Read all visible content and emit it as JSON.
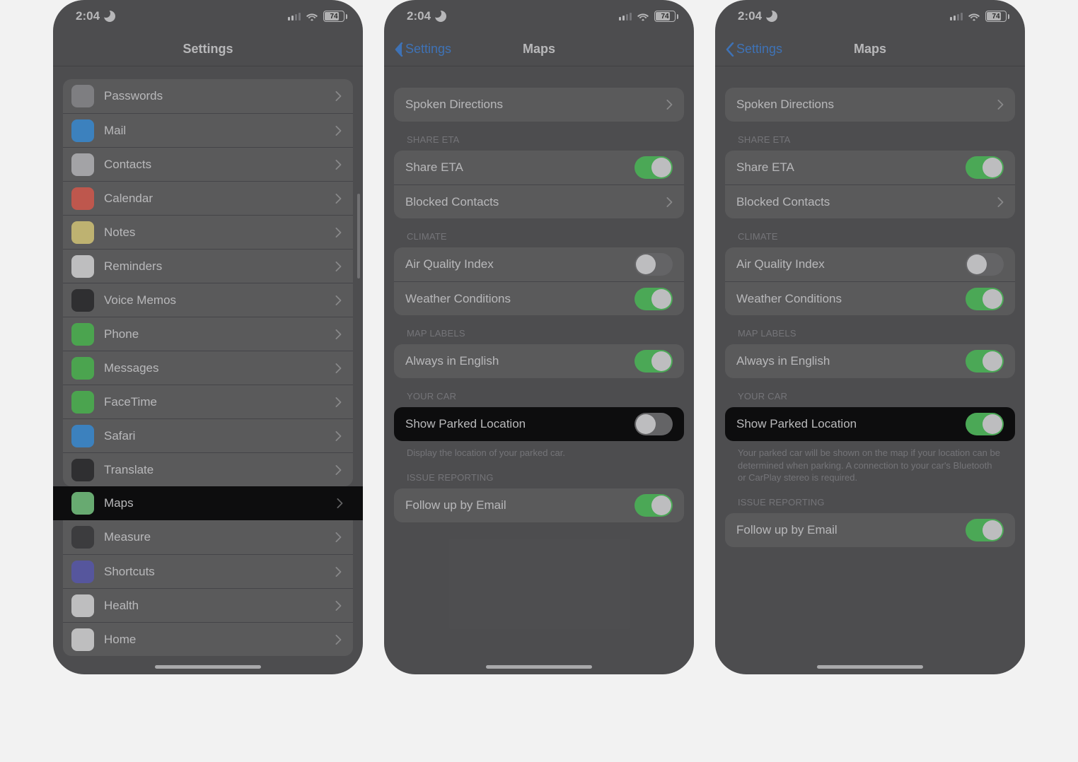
{
  "status": {
    "time": "2:04",
    "battery": "74"
  },
  "screen1": {
    "title": "Settings",
    "items": [
      {
        "label": "Passwords",
        "iconName": "key-icon",
        "iconBg": "#9a9a9e"
      },
      {
        "label": "Mail",
        "iconName": "mail-icon",
        "iconBg": "#4a9ee8"
      },
      {
        "label": "Contacts",
        "iconName": "contacts-icon",
        "iconBg": "#c7c7cb"
      },
      {
        "label": "Calendar",
        "iconName": "calendar-icon",
        "iconBg": "#e86b5e"
      },
      {
        "label": "Notes",
        "iconName": "notes-icon",
        "iconBg": "#e8d98a"
      },
      {
        "label": "Reminders",
        "iconName": "reminders-icon",
        "iconBg": "#e8e8ea"
      },
      {
        "label": "Voice Memos",
        "iconName": "voicememo-icon",
        "iconBg": "#3a3a3c"
      },
      {
        "label": "Phone",
        "iconName": "phone-icon",
        "iconBg": "#5cc961"
      },
      {
        "label": "Messages",
        "iconName": "messages-icon",
        "iconBg": "#5cc961"
      },
      {
        "label": "FaceTime",
        "iconName": "facetime-icon",
        "iconBg": "#5cc961"
      },
      {
        "label": "Safari",
        "iconName": "safari-icon",
        "iconBg": "#4a9ee8"
      },
      {
        "label": "Translate",
        "iconName": "translate-icon",
        "iconBg": "#3a3a3c"
      },
      {
        "label": "Maps",
        "iconName": "maps-icon",
        "iconBg": "#7fd08a",
        "hilite": true
      },
      {
        "label": "Measure",
        "iconName": "measure-icon",
        "iconBg": "#4a4a4c"
      },
      {
        "label": "Shortcuts",
        "iconName": "shortcuts-icon",
        "iconBg": "#6a6ac0"
      },
      {
        "label": "Health",
        "iconName": "health-icon",
        "iconBg": "#e8e8ea"
      },
      {
        "label": "Home",
        "iconName": "home-icon",
        "iconBg": "#e8e8ea"
      }
    ]
  },
  "screen2": {
    "back": "Settings",
    "title": "Maps",
    "spoken_directions": "Spoken Directions",
    "share_eta_hdr": "SHARE ETA",
    "share_eta": "Share ETA",
    "blocked_contacts": "Blocked Contacts",
    "climate_hdr": "CLIMATE",
    "air_quality": "Air Quality Index",
    "weather": "Weather Conditions",
    "map_labels_hdr": "MAP LABELS",
    "always_english": "Always in English",
    "your_car_hdr": "YOUR CAR",
    "show_parked": "Show Parked Location",
    "parked_footer_off": "Display the location of your parked car.",
    "issue_hdr": "ISSUE REPORTING",
    "follow_up": "Follow up by Email",
    "toggles": {
      "share_eta": true,
      "air_quality": false,
      "weather": true,
      "always_english": true,
      "show_parked": false,
      "follow_up": true
    }
  },
  "screen3": {
    "back": "Settings",
    "title": "Maps",
    "parked_footer_on": "Your parked car will be shown on the map if your location can be determined when parking. A connection to your car's Bluetooth or CarPlay stereo is required.",
    "toggles": {
      "share_eta": true,
      "air_quality": false,
      "weather": true,
      "always_english": true,
      "show_parked": true,
      "follow_up": true
    }
  }
}
